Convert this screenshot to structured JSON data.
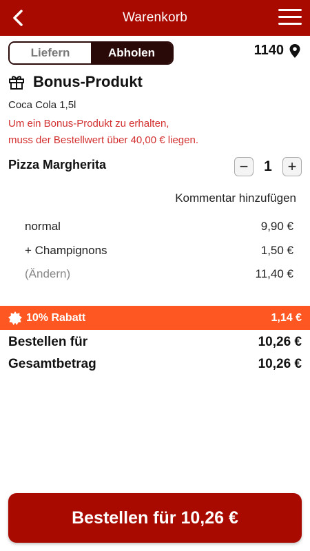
{
  "header": {
    "title": "Warenkorb",
    "back_icon": "chevron-left-icon",
    "menu_icon": "hamburger-menu-icon"
  },
  "delivery_toggle": {
    "options": [
      "Liefern",
      "Abholen"
    ],
    "selected": "Abholen"
  },
  "location": {
    "postal_code": "1140",
    "icon": "location-pin-icon"
  },
  "bonus": {
    "icon": "gift-icon",
    "heading": "Bonus-Produkt",
    "product": "Coca Cola 1,5l",
    "notice_line1": "Um ein Bonus-Produkt zu erhalten,",
    "notice_line2": "muss der Bestellwert über 40,00 € liegen."
  },
  "cart_item": {
    "name": "Pizza Margherita",
    "quantity": "1",
    "decrease_symbol": "−",
    "increase_symbol": "+",
    "comment_label": "Kommentar hinzufügen",
    "lines": [
      {
        "label": "normal",
        "price": "9,90 €"
      },
      {
        "label": "+ Champignons",
        "price": "1,50 €"
      },
      {
        "label": "(Ändern)",
        "price": "11,40 €"
      }
    ]
  },
  "discount": {
    "label": "10% Rabatt",
    "amount": "1,14 €",
    "icon": "badge-icon"
  },
  "totals": [
    {
      "label": "Bestellen für",
      "value": "10,26 €"
    },
    {
      "label": "Gesamtbetrag",
      "value": "10,26 €"
    }
  ],
  "order_button": {
    "label": "Bestellen für 10,26 €"
  },
  "colors": {
    "primary": "#a80a00",
    "toggle_dark": "#2a0a08",
    "discount": "#ff5722",
    "warning": "#d32f2f"
  }
}
